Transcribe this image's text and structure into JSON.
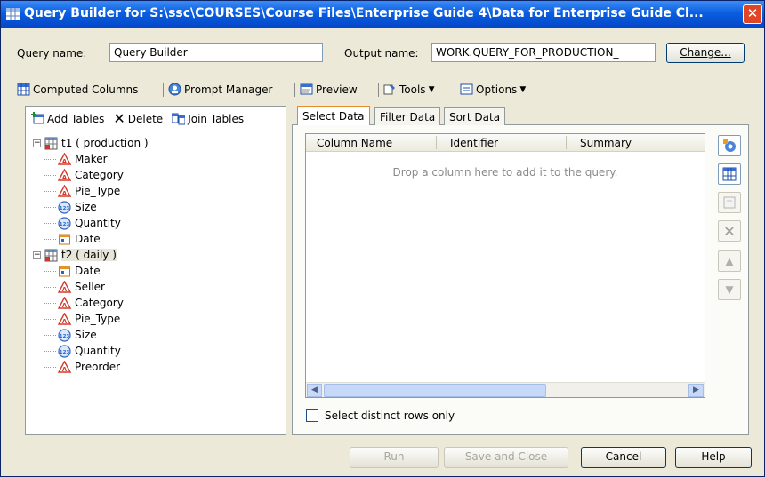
{
  "window": {
    "title": "Query Builder for S:\\ssc\\COURSES\\Course Files\\Enterprise Guide 4\\Data for Enterprise Guide Cl..."
  },
  "query": {
    "name_label": "Query name:",
    "name_value": "Query Builder",
    "output_label": "Output name:",
    "output_value": "WORK.QUERY_FOR_PRODUCTION_",
    "change_label": "Change..."
  },
  "toolbar": {
    "computed_columns": "Computed Columns",
    "prompt_manager": "Prompt Manager",
    "preview": "Preview",
    "tools": "Tools",
    "options": "Options"
  },
  "tree_toolbar": {
    "add_tables": "Add Tables",
    "delete": "Delete",
    "join_tables": "Join Tables"
  },
  "tree": {
    "tables": [
      {
        "label": "t1 ( production )",
        "columns": [
          {
            "name": "Maker",
            "type": "char"
          },
          {
            "name": "Category",
            "type": "char"
          },
          {
            "name": "Pie_Type",
            "type": "char"
          },
          {
            "name": "Size",
            "type": "num"
          },
          {
            "name": "Quantity",
            "type": "num"
          },
          {
            "name": "Date",
            "type": "date"
          }
        ]
      },
      {
        "label": "t2 ( daily )",
        "columns": [
          {
            "name": "Date",
            "type": "date"
          },
          {
            "name": "Seller",
            "type": "char"
          },
          {
            "name": "Category",
            "type": "char"
          },
          {
            "name": "Pie_Type",
            "type": "char"
          },
          {
            "name": "Size",
            "type": "num"
          },
          {
            "name": "Quantity",
            "type": "num"
          },
          {
            "name": "Preorder",
            "type": "char"
          }
        ]
      }
    ]
  },
  "tabs": [
    "Select Data",
    "Filter Data",
    "Sort Data"
  ],
  "grid": {
    "columns": [
      "Column Name",
      "Identifier",
      "Summary"
    ],
    "empty_text": "Drop a column here to add it to the query."
  },
  "distinct_label": "Select distinct rows only",
  "footer": {
    "run": "Run",
    "save_close": "Save and Close",
    "cancel": "Cancel",
    "help": "Help"
  }
}
